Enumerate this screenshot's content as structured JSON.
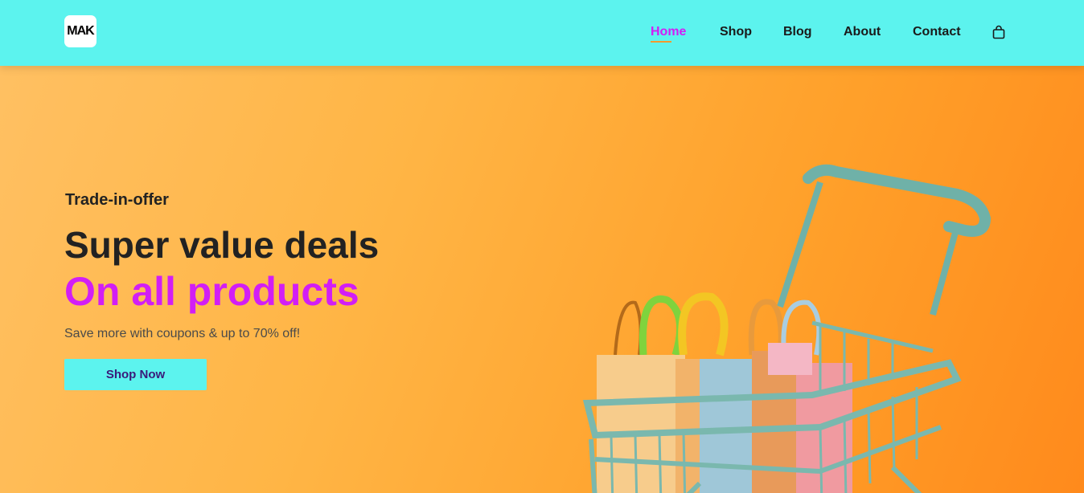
{
  "brand": {
    "logo_text": "MAK"
  },
  "nav": {
    "items": [
      {
        "label": "Home",
        "active": true
      },
      {
        "label": "Shop",
        "active": false
      },
      {
        "label": "Blog",
        "active": false
      },
      {
        "label": "About",
        "active": false
      },
      {
        "label": "Contact",
        "active": false
      }
    ],
    "cart_icon": "shopping-bag-icon"
  },
  "hero": {
    "eyebrow": "Trade-in-offer",
    "headline": "Super value deals",
    "subheadline": "On all products",
    "description": "Save more with coupons & up to 70% off!",
    "cta_label": "Shop Now",
    "illustration": "shopping-cart-with-bags"
  },
  "colors": {
    "header_bg": "#5cf3ee",
    "accent": "#d21ef5",
    "hero_bg": "#ffb347",
    "cta_bg": "#5cf3ee"
  }
}
